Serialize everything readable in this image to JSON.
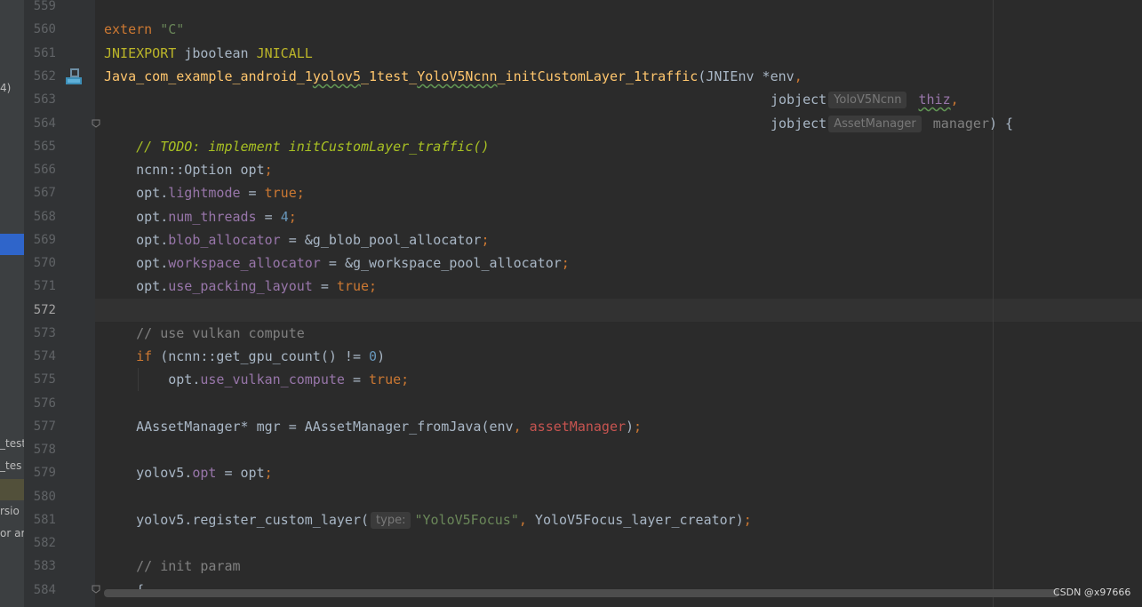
{
  "left_panel": {
    "fragments": [
      "4)",
      "_test",
      "_tes",
      "rsio",
      "or ar"
    ]
  },
  "editor": {
    "line_numbers": [
      "559",
      "560",
      "561",
      "562",
      "563",
      "564",
      "565",
      "566",
      "567",
      "568",
      "569",
      "570",
      "571",
      "572",
      "573",
      "574",
      "575",
      "576",
      "577",
      "578",
      "579",
      "580",
      "581",
      "582",
      "583",
      "584"
    ],
    "current_line_number": "572",
    "tokens": {
      "extern": "extern",
      "c_str": "\"C\"",
      "jniexport": "JNIEXPORT",
      "jboolean": "jboolean",
      "jnicall": "JNICALL",
      "fn_a": "Java_com_example_android_1",
      "fn_b": "yolov5",
      "fn_c": "_1test_",
      "fn_d": "YoloV5Ncnn",
      "fn_e": "_initCustomLayer_1traffic",
      "paren_open": "(",
      "jnienv": "JNIEnv *env",
      "comma": ",",
      "jobject1": "jobject",
      "hint_thiz_type": "YoloV5Ncnn",
      "thiz": "thiz",
      "jobject2": "jobject",
      "hint_mgr_type": "AssetManager",
      "manager_param": "manager",
      "close_brace_open": ") {",
      "todo_comment": "// TODO: implement initCustomLayer_traffic()",
      "option_decl": "ncnn::Option opt",
      "semi": ";",
      "opt": "opt.",
      "lightmode": "lightmode",
      "eq": " = ",
      "true_kw": "true",
      "num_threads": "num_threads",
      "four": "4",
      "blob_allocator": "blob_allocator",
      "blob_pool": "&g_blob_pool_allocator",
      "workspace_allocator": "workspace_allocator",
      "workspace_pool": "&g_workspace_pool_allocator",
      "use_packing_layout": "use_packing_layout",
      "vulkan_comment": "// use vulkan compute",
      "if_kw": "if",
      "gpu_count": " (ncnn::get_gpu_count() != ",
      "zero": "0",
      "close_paren": ")",
      "use_vulkan_compute": "use_vulkan_compute",
      "mgr_decl": "AAssetManager* mgr = AAssetManager_fromJava(env",
      "asset_manager": "assetManager",
      "yolov5_dot": "yolov5.",
      "opt_field": "opt",
      "eq_opt": " = opt",
      "register": "yolov5.register_custom_layer(",
      "hint_type": "type:",
      "focus_str": "\"YoloV5Focus\"",
      "creator": " YoloV5Focus_layer_creator)",
      "init_comment": "// init param",
      "brace": "{"
    }
  },
  "watermark": "CSDN @x97666",
  "colors": {
    "background": "#2b2b2b",
    "gutter": "#313335",
    "keyword": "#cc7832",
    "string": "#6a8759",
    "function": "#ffc66d",
    "field": "#9876aa",
    "number": "#6897bb",
    "comment": "#808080"
  },
  "icons": [
    "bookmark-icon",
    "fold-icon",
    "fold-icon"
  ]
}
